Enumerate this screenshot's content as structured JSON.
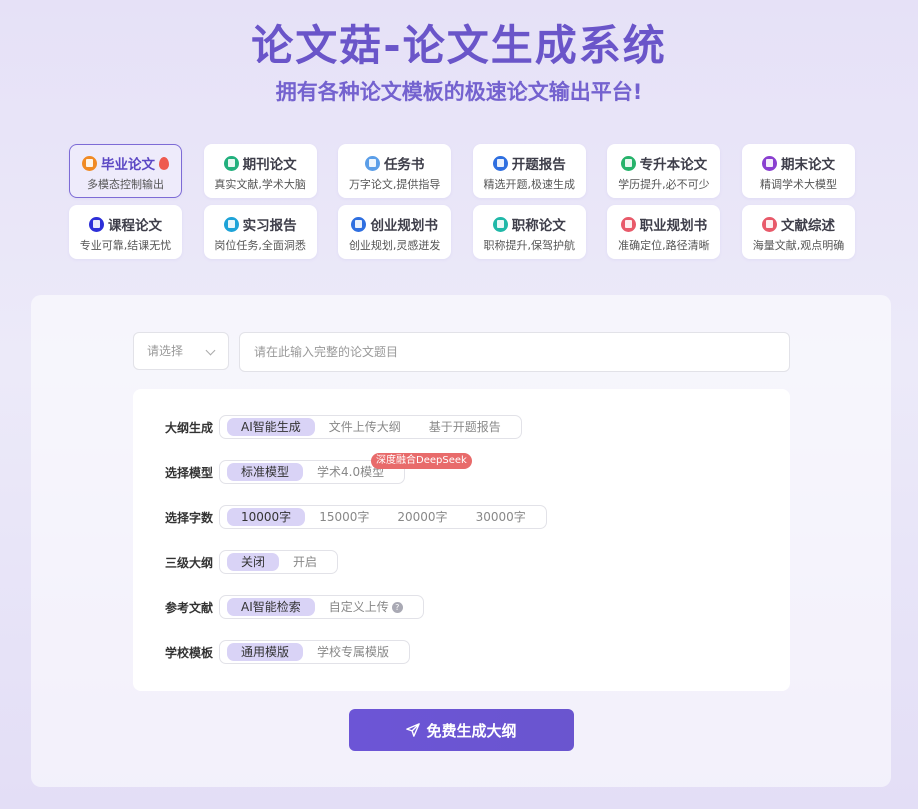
{
  "header": {
    "title": "论文菇-论文生成系统",
    "subtitle": "拥有各种论文模板的极速论文输出平台!"
  },
  "categories": [
    {
      "name": "毕业论文",
      "desc": "多模态控制输出",
      "color": "#f08a24",
      "icon": "doc-icon",
      "active": true,
      "hot": true
    },
    {
      "name": "期刊论文",
      "desc": "真实文献,学术大脑",
      "color": "#22b07d",
      "icon": "doc-icon"
    },
    {
      "name": "任务书",
      "desc": "万字论文,提供指导",
      "color": "#5b9ee8",
      "icon": "doc-icon"
    },
    {
      "name": "开题报告",
      "desc": "精选开题,极速生成",
      "color": "#2f6fe0",
      "icon": "doc-icon"
    },
    {
      "name": "专升本论文",
      "desc": "学历提升,必不可少",
      "color": "#27b36b",
      "icon": "doc-icon"
    },
    {
      "name": "期末论文",
      "desc": "精调学术大模型",
      "color": "#8a3fd0",
      "icon": "doc-icon"
    },
    {
      "name": "课程论文",
      "desc": "专业可靠,结课无忧",
      "color": "#2d2fd8",
      "icon": "doc-icon"
    },
    {
      "name": "实习报告",
      "desc": "岗位任务,全面洞悉",
      "color": "#1ea3d8",
      "icon": "doc-icon"
    },
    {
      "name": "创业规划书",
      "desc": "创业规划,灵感迸发",
      "color": "#2f6fe0",
      "icon": "doc-icon"
    },
    {
      "name": "职称论文",
      "desc": "职称提升,保驾护航",
      "color": "#20b8a8",
      "icon": "doc-icon"
    },
    {
      "name": "职业规划书",
      "desc": "准确定位,路径清晰",
      "color": "#e85a6a",
      "icon": "doc-icon"
    },
    {
      "name": "文献综述",
      "desc": "海量文献,观点明确",
      "color": "#e85a6a",
      "icon": "doc-icon"
    }
  ],
  "topic": {
    "select_placeholder": "请选择",
    "input_placeholder": "请在此输入完整的论文题目"
  },
  "options": {
    "outline": {
      "label": "大纲生成",
      "items": [
        "AI智能生成",
        "文件上传大纲",
        "基于开题报告"
      ],
      "selected": 0
    },
    "model": {
      "label": "选择模型",
      "items": [
        "标准模型",
        "学术4.0模型"
      ],
      "selected": 0,
      "badge": "深度融合DeepSeek"
    },
    "words": {
      "label": "选择字数",
      "items": [
        "10000字",
        "15000字",
        "20000字",
        "30000字"
      ],
      "selected": 0
    },
    "level3": {
      "label": "三级大纲",
      "items": [
        "关闭",
        "开启"
      ],
      "selected": 0
    },
    "refs": {
      "label": "参考文献",
      "items": [
        "AI智能检索",
        "自定义上传"
      ],
      "selected": 0,
      "help": "?"
    },
    "template": {
      "label": "学校模板",
      "items": [
        "通用模版",
        "学校专属模版"
      ],
      "selected": 0
    }
  },
  "generate_button": "免费生成大纲",
  "colors": {
    "accent": "#6c55d6",
    "accent_light": "#d9d3f6",
    "badge": "#e86b6b"
  }
}
